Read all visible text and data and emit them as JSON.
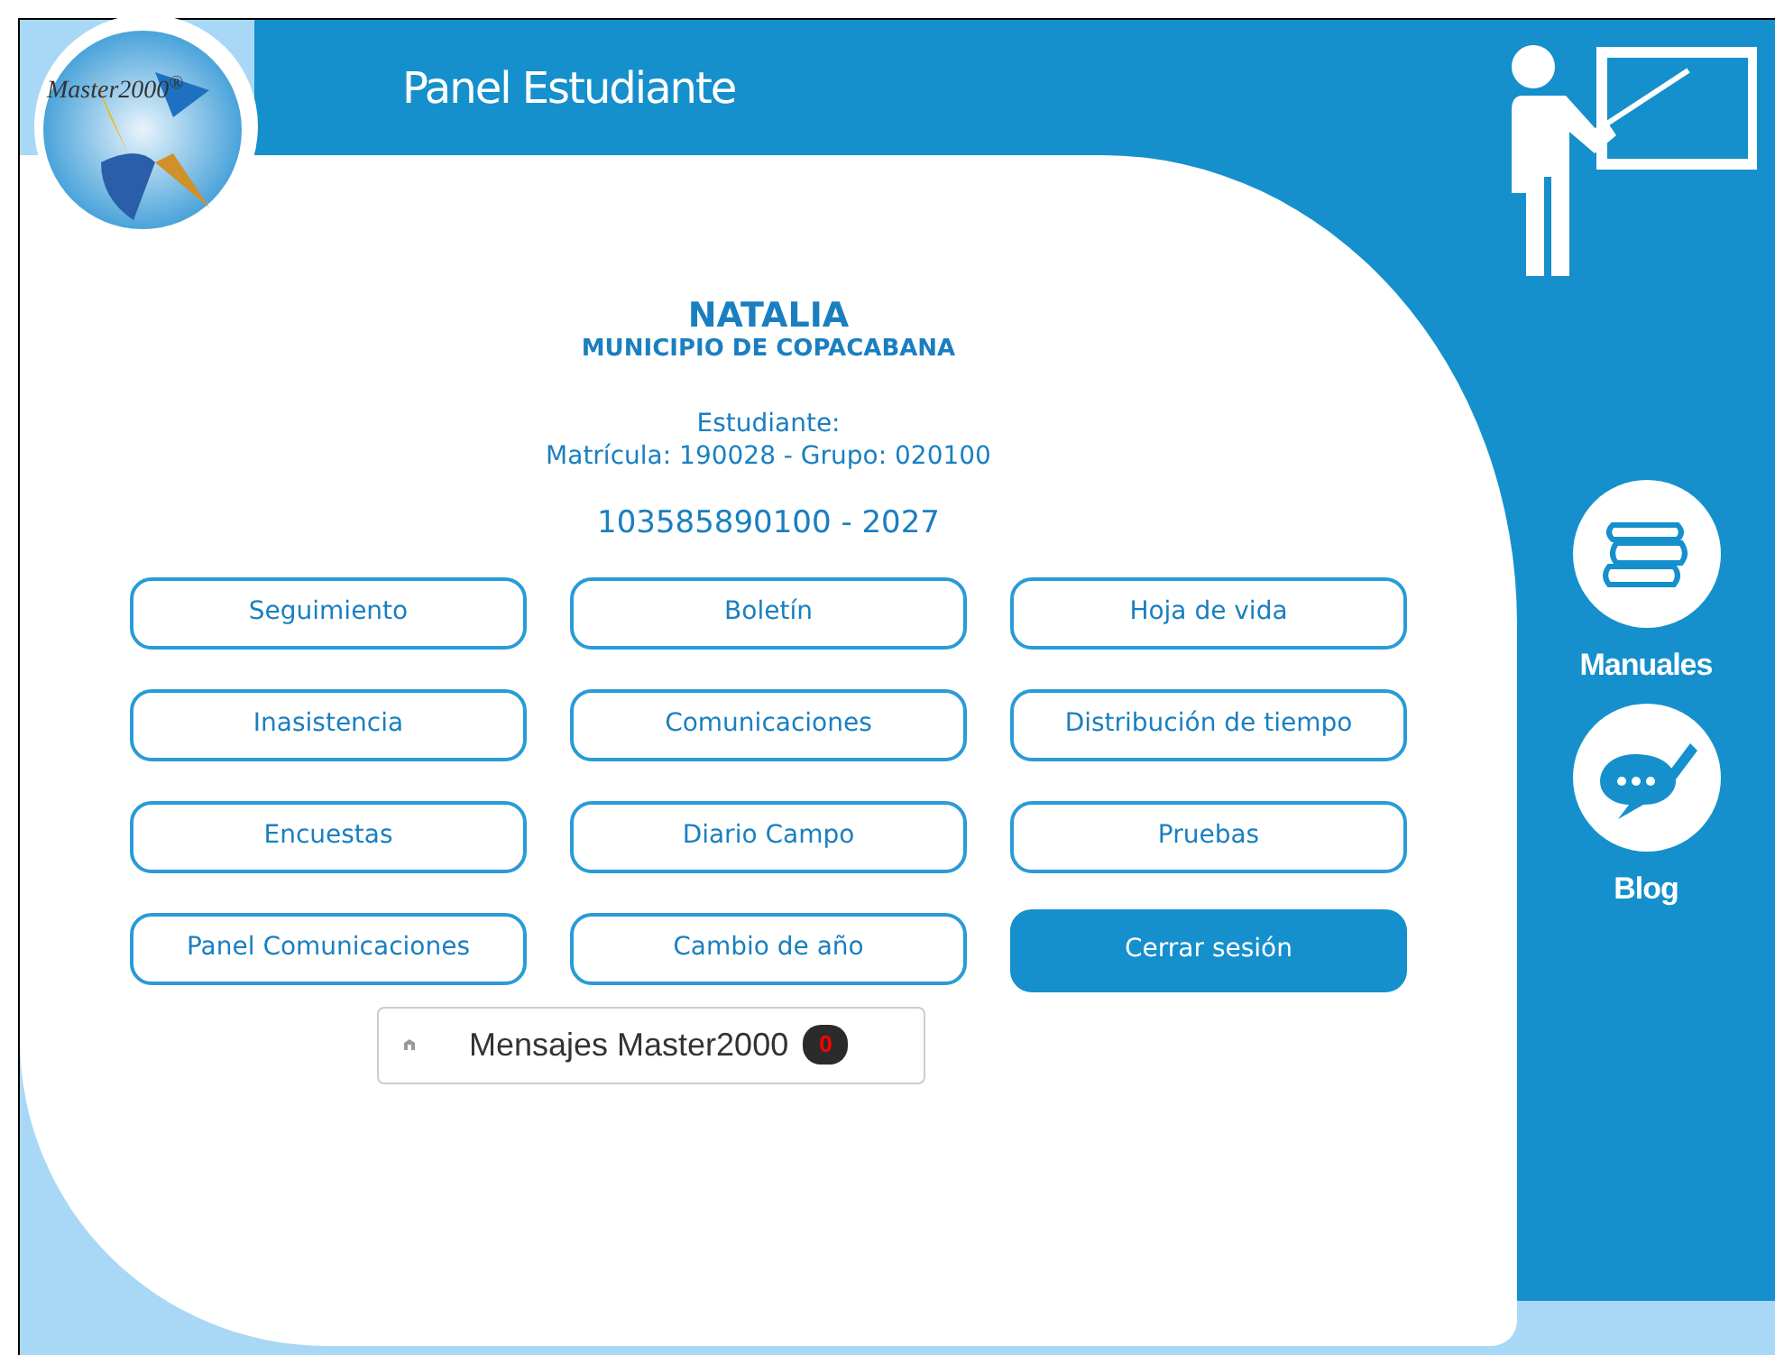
{
  "logo": {
    "text": "Master2000$^{®}$"
  },
  "header": {
    "title": "Panel Estudiante"
  },
  "student": {
    "name": "NATALIA",
    "municipality": "MUNICIPIO DE COPACABANA",
    "role": "Estudiante:",
    "enrollment": "Matrícula: 190028 - Grupo: 020100",
    "id_line": "103585890100 - 2027"
  },
  "buttons": [
    {
      "label": "Seguimiento",
      "kind": "outline"
    },
    {
      "label": "Boletín",
      "kind": "outline"
    },
    {
      "label": "Hoja de vida",
      "kind": "outline"
    },
    {
      "label": "Inasistencia",
      "kind": "outline"
    },
    {
      "label": "Comunicaciones",
      "kind": "outline"
    },
    {
      "label": "Distribución de tiempo",
      "kind": "outline"
    },
    {
      "label": "Encuestas",
      "kind": "outline"
    },
    {
      "label": "Diario Campo",
      "kind": "outline"
    },
    {
      "label": "Pruebas",
      "kind": "outline"
    },
    {
      "label": "Panel Comunicaciones",
      "kind": "outline"
    },
    {
      "label": "Cambio de año",
      "kind": "outline"
    },
    {
      "label": "Cerrar sesión",
      "kind": "filled"
    }
  ],
  "messages": {
    "label": "Mensajes Master2000",
    "count": "0"
  },
  "side_links": [
    {
      "label": "Manuales",
      "kind": "books"
    },
    {
      "label": "Blog",
      "kind": "chat"
    }
  ]
}
